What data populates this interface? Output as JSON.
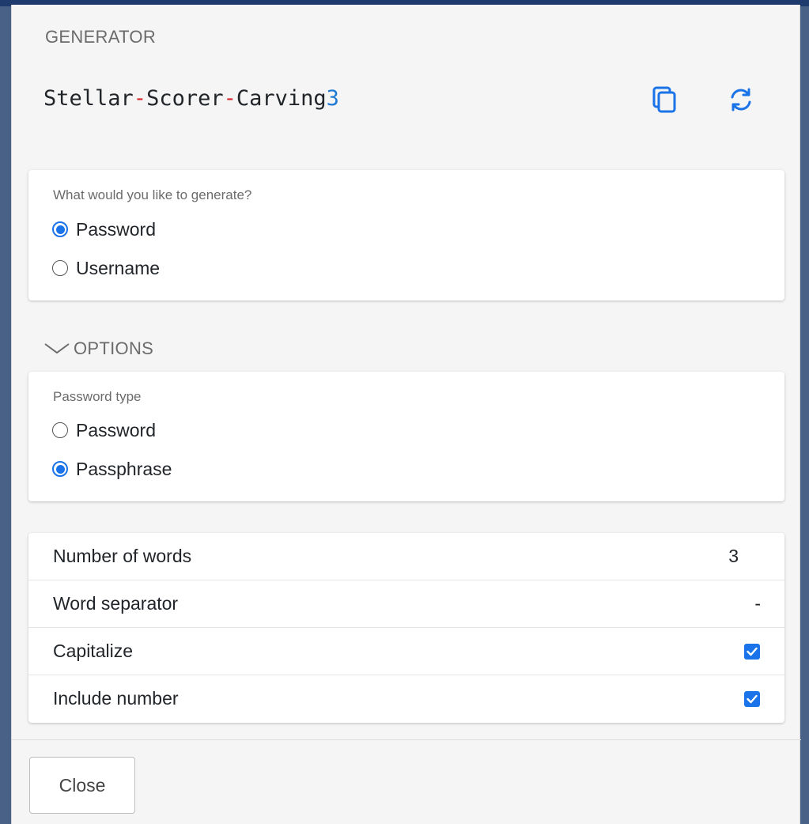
{
  "header": {
    "title": "GENERATOR"
  },
  "generated": {
    "parts": [
      {
        "text": "Stellar",
        "kind": "word"
      },
      {
        "text": "-",
        "kind": "sep"
      },
      {
        "text": "Scorer",
        "kind": "word"
      },
      {
        "text": "-",
        "kind": "sep"
      },
      {
        "text": "Carving",
        "kind": "word"
      },
      {
        "text": "3",
        "kind": "num"
      }
    ],
    "copy_icon": "copy-icon",
    "regenerate_icon": "refresh-icon"
  },
  "generate_type": {
    "question": "What would you like to generate?",
    "options": [
      {
        "label": "Password",
        "checked": true
      },
      {
        "label": "Username",
        "checked": false
      }
    ]
  },
  "options_toggle": {
    "label": "OPTIONS",
    "icon": "chevron-down-icon"
  },
  "password_type": {
    "label": "Password type",
    "options": [
      {
        "label": "Password",
        "checked": false
      },
      {
        "label": "Passphrase",
        "checked": true
      }
    ]
  },
  "passphrase_options": {
    "num_words": {
      "label": "Number of words",
      "value": "3"
    },
    "word_separator": {
      "label": "Word separator",
      "value": "-"
    },
    "capitalize": {
      "label": "Capitalize",
      "checked": true
    },
    "include_number": {
      "label": "Include number",
      "checked": true
    }
  },
  "footer": {
    "close_label": "Close"
  },
  "colors": {
    "accent": "#1a73e8",
    "separator": "#d9272e",
    "number": "#1f7ad6",
    "backdrop": "#4a6187"
  }
}
